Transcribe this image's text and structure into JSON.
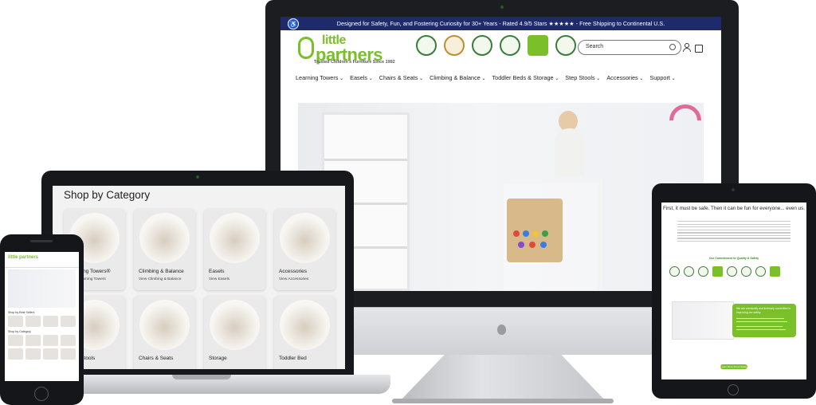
{
  "desktop": {
    "announcement": "Designed for Safety, Fun, and Fostering Curiosity for 30+ Years - Rated 4.9/5 Stars ★★★★★ - Free Shipping to Continental U.S.",
    "brand": {
      "line1": "little",
      "line2": "partners",
      "tagline": "Trusted Children's Furniture Since 1992"
    },
    "search_placeholder": "Search",
    "nav": [
      "Learning Towers",
      "Easels",
      "Chairs & Seats",
      "Climbing & Balance",
      "Toddler Beds & Storage",
      "Step Stools",
      "Accessories",
      "Support"
    ]
  },
  "laptop": {
    "title": "Shop by Category",
    "categories": [
      {
        "name": "Learning Towers®",
        "link": "View Learning Towers"
      },
      {
        "name": "Climbing & Balance",
        "link": "View Climbing & Balance"
      },
      {
        "name": "Easels",
        "link": "View Easels"
      },
      {
        "name": "Accessories",
        "link": "View Accessories"
      },
      {
        "name": "Step Stools",
        "link": ""
      },
      {
        "name": "Chairs & Seats",
        "link": ""
      },
      {
        "name": "Storage",
        "link": ""
      },
      {
        "name": "Toddler Bed",
        "link": ""
      }
    ]
  },
  "phone": {
    "logo": "little partners",
    "section1": "Shop by Best Sellers",
    "section2": "Shop by Category"
  },
  "tablet": {
    "headline": "First, it must be safe. Then it can be fun for everyone... even us.",
    "subhead": "Our Commitment to Quality & Safety",
    "feature_title": "We are constantly and tirelessly committed to improving our safety",
    "button": "Learn More About Safety"
  },
  "colors": {
    "brand_green": "#7bbf2a",
    "announcement_bg": "#1e2a6c",
    "device_frame": "#17181b"
  }
}
